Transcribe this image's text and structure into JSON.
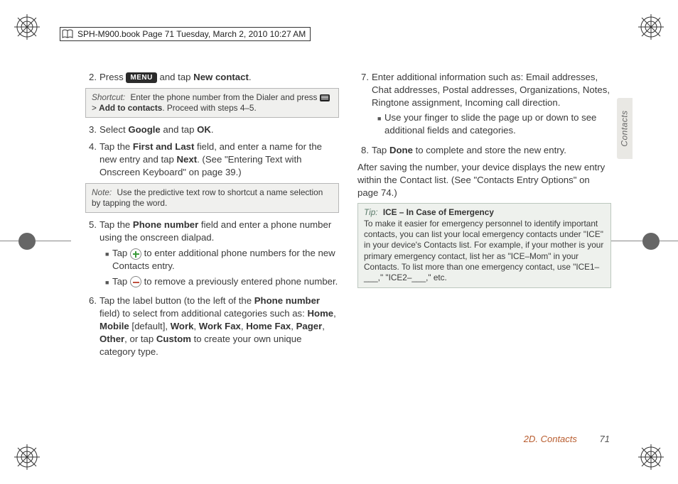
{
  "header": {
    "text": "SPH-M900.book  Page 71  Tuesday, March 2, 2010  10:27 AM"
  },
  "sideTab": {
    "label": "Contacts"
  },
  "footer": {
    "section": "2D. Contacts",
    "page": "71"
  },
  "menuPill": "MENU",
  "left": {
    "s2_a": "Press ",
    "s2_b": " and tap ",
    "s2_bold": "New contact",
    "s2_c": ".",
    "shortcut_label": "Shortcut:",
    "shortcut_a": "Enter the phone number from the Dialer and press ",
    "shortcut_b": " > ",
    "shortcut_bold": "Add to contacts",
    "shortcut_c": ". Proceed with steps 4–5.",
    "s3_a": "Select ",
    "s3_b1": "Google",
    "s3_b": " and tap ",
    "s3_b2": "OK",
    "s3_c": ".",
    "s4_a": "Tap the ",
    "s4_b1": "First and Last",
    "s4_b": " field, and enter a name for the new entry and tap ",
    "s4_b2": "Next",
    "s4_c": ". (See \"Entering Text with Onscreen Keyboard\" on page 39.)",
    "note_label": "Note:",
    "note_text": "Use the predictive text row to shortcut a name selection by tapping the word.",
    "s5_a": "Tap the ",
    "s5_b1": "Phone number",
    "s5_b": " field and enter a phone number using the onscreen dialpad.",
    "s5_sub1_a": "Tap ",
    "s5_sub1_b": " to enter additional phone numbers for the new Contacts entry.",
    "s5_sub2_a": "Tap ",
    "s5_sub2_b": " to remove a previously entered phone number.",
    "s6_a": "Tap the label button (to the left of the ",
    "s6_b1": "Phone number",
    "s6_b": " field) to select from additional categories such as: ",
    "s6_home": "Home",
    "s6_mobile": "Mobile",
    "s6_def": " [default], ",
    "s6_work": "Work",
    "s6_wfax": "Work Fax",
    "s6_hfax": "Home Fax",
    "s6_pager": "Pager",
    "s6_other": "Other",
    "s6_ortap": ", or tap ",
    "s6_custom": "Custom",
    "s6_end": " to create your own unique category type.",
    "comma": ", "
  },
  "right": {
    "s7": "Enter additional information such as: Email addresses, Chat addresses, Postal addresses, Organizations, Notes, Ringtone assignment, Incoming call direction.",
    "s7_sub": "Use your finger to slide the page up or down to see additional fields and categories.",
    "s8_a": "Tap ",
    "s8_b1": "Done",
    "s8_b": " to complete and store the new entry.",
    "after": "After saving the number, your device displays the new entry within the Contact list. (See \"Contacts Entry Options\" on page 74.)",
    "tip_label": "Tip:",
    "tip_title": "ICE – In Case of Emergency",
    "tip_body": "To make it easier for emergency personnel to identify important contacts, you can list your local emergency contacts under \"ICE\" in your device's Contacts list. For example, if your mother is your primary emergency contact, list her as \"ICE–Mom\" in your Contacts. To list more than one emergency contact, use \"ICE1–___,\" \"ICE2–___,\" etc."
  },
  "nums": {
    "n2": "2.",
    "n3": "3.",
    "n4": "4.",
    "n5": "5.",
    "n6": "6.",
    "n7": "7.",
    "n8": "8."
  }
}
